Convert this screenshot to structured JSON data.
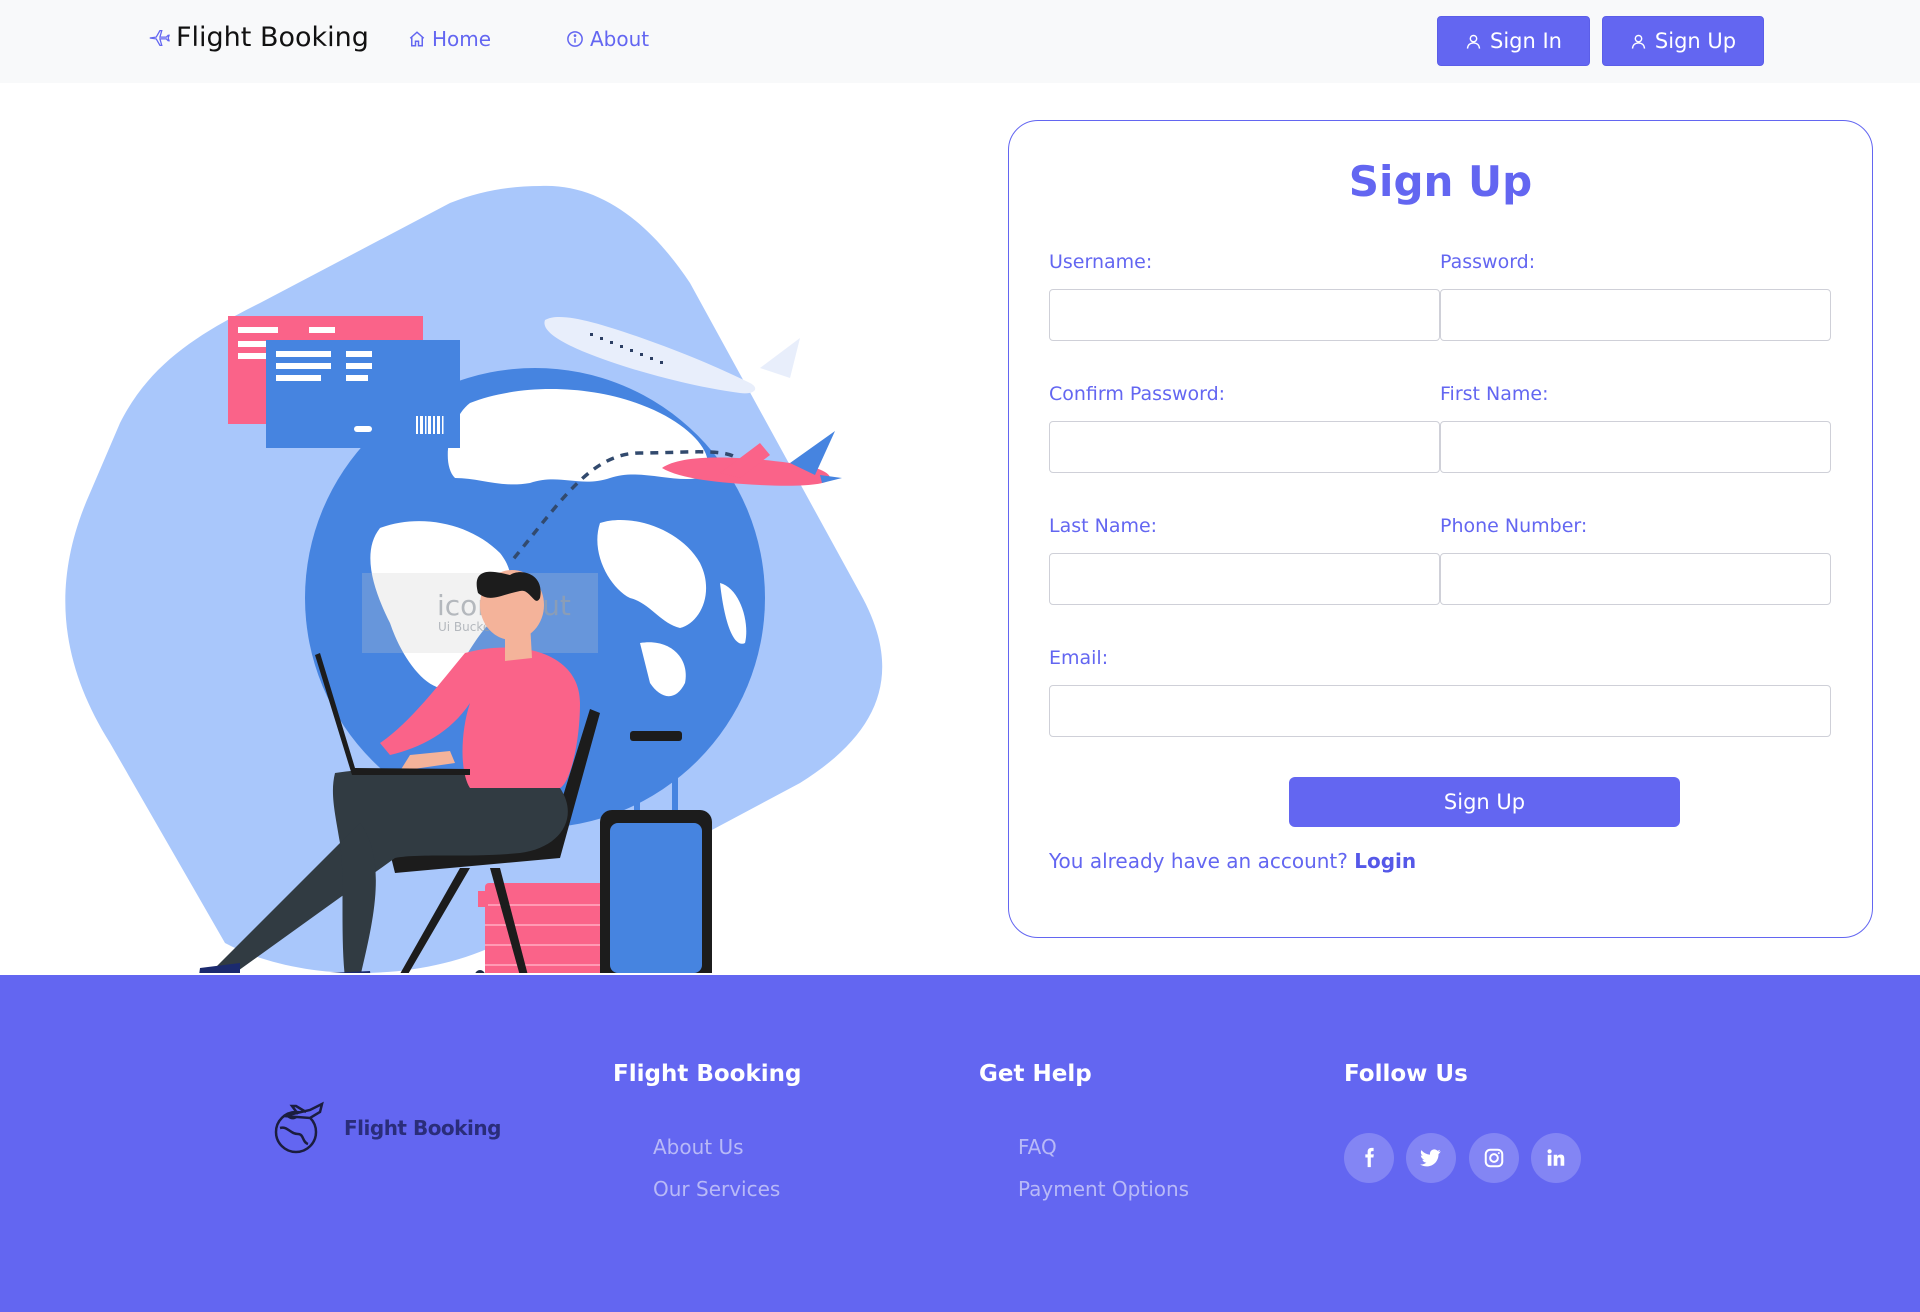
{
  "nav": {
    "brand": "Flight Booking",
    "home": "Home",
    "about": "About",
    "sign_in": "Sign In",
    "sign_up": "Sign Up"
  },
  "illustration": {
    "watermark_brand": "iconscout",
    "watermark_sub": "Ui Bucket"
  },
  "form": {
    "title": "Sign Up",
    "username_label": "Username:",
    "password_label": "Password:",
    "confirm_password_label": "Confirm Password:",
    "first_name_label": "First Name:",
    "last_name_label": "Last Name:",
    "phone_label": "Phone Number:",
    "email_label": "Email:",
    "username_value": "",
    "password_value": "",
    "confirm_password_value": "",
    "first_name_value": "",
    "last_name_value": "",
    "phone_value": "",
    "email_value": "",
    "submit_label": "Sign Up",
    "have_account_text": "You already have an account?",
    "login_label": "Login"
  },
  "footer": {
    "logo_text": "Flight Booking",
    "col1_heading": "Flight Booking",
    "col1_links": [
      "About Us",
      "Our Services"
    ],
    "col2_heading": "Get Help",
    "col2_links": [
      "FAQ",
      "Payment Options"
    ],
    "col3_heading": "Follow Us",
    "social": [
      "facebook-icon",
      "twitter-icon",
      "instagram-icon",
      "linkedin-icon"
    ]
  },
  "colors": {
    "accent": "#6366f1",
    "blob": "#a9c7fb",
    "globe": "#4684e0",
    "pink": "#fa6389",
    "dark": "#313b42"
  }
}
